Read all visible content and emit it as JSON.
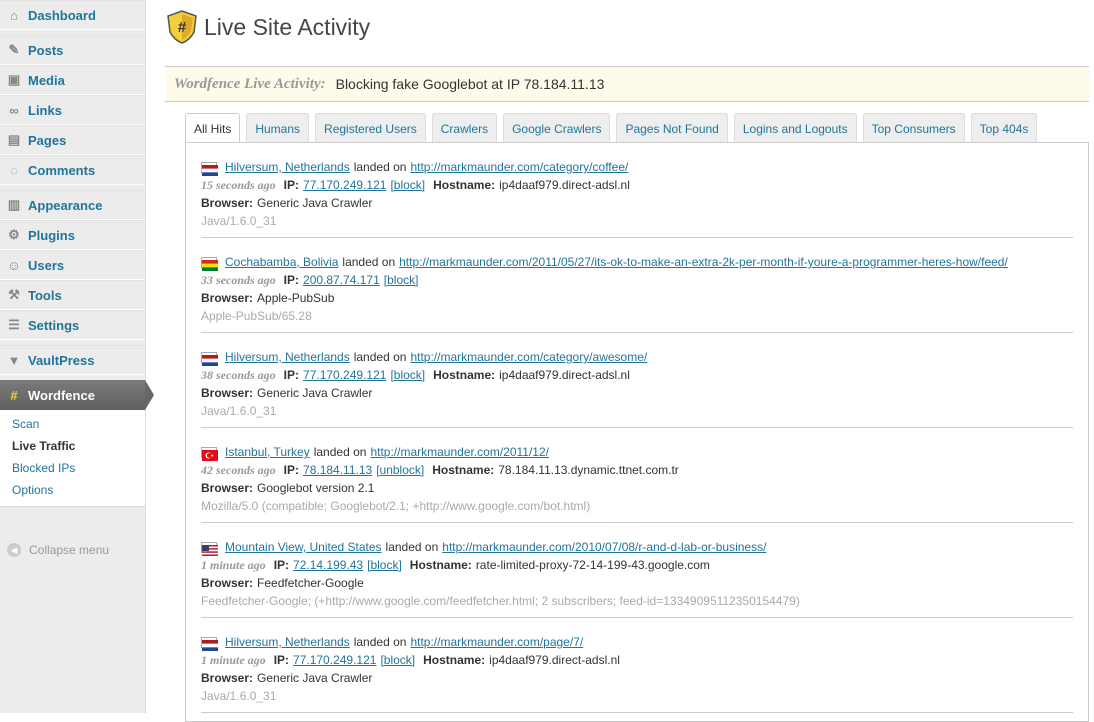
{
  "sidebar": {
    "items": [
      {
        "label": "Dashboard",
        "icon": "home-icon"
      },
      {
        "label": "Posts",
        "icon": "pin-icon"
      },
      {
        "label": "Media",
        "icon": "media-icon"
      },
      {
        "label": "Links",
        "icon": "link-icon"
      },
      {
        "label": "Pages",
        "icon": "pages-icon"
      },
      {
        "label": "Comments",
        "icon": "comment-icon"
      },
      {
        "label": "Appearance",
        "icon": "appearance-icon"
      },
      {
        "label": "Plugins",
        "icon": "plugin-icon"
      },
      {
        "label": "Users",
        "icon": "users-icon"
      },
      {
        "label": "Tools",
        "icon": "tools-icon"
      },
      {
        "label": "Settings",
        "icon": "settings-icon"
      },
      {
        "label": "VaultPress",
        "icon": "vaultpress-icon"
      },
      {
        "label": "Wordfence",
        "icon": "wordfence-icon"
      }
    ],
    "submenu": [
      "Scan",
      "Live Traffic",
      "Blocked IPs",
      "Options"
    ],
    "collapse": "Collapse menu"
  },
  "page": {
    "title": "Live Site Activity"
  },
  "livebar": {
    "label": "Wordfence Live Activity:",
    "message": "Blocking fake Googlebot at IP 78.184.11.13"
  },
  "tabs": [
    "All Hits",
    "Humans",
    "Registered Users",
    "Crawlers",
    "Google Crawlers",
    "Pages Not Found",
    "Logins and Logouts",
    "Top Consumers",
    "Top 404s"
  ],
  "labels": {
    "landed": "landed on",
    "ip": "IP:",
    "hostname": "Hostname:",
    "browser": "Browser:"
  },
  "hits": [
    {
      "location": "Hilversum, Netherlands",
      "url": "http://markmaunder.com/category/coffee/",
      "ago": "15 seconds ago",
      "ip": "77.170.249.121",
      "action": "[block]",
      "hostname": "ip4daaf979.direct-adsl.nl",
      "browser": "Generic Java Crawler",
      "ua": "Java/1.6.0_31",
      "flag": "nl"
    },
    {
      "location": "Cochabamba, Bolivia",
      "url": "http://markmaunder.com/2011/05/27/its-ok-to-make-an-extra-2k-per-month-if-youre-a-programmer-heres-how/feed/",
      "ago": "33 seconds ago",
      "ip": "200.87.74.171",
      "action": "[block]",
      "hostname": "",
      "browser": "Apple-PubSub",
      "ua": "Apple-PubSub/65.28",
      "flag": "bo"
    },
    {
      "location": "Hilversum, Netherlands",
      "url": "http://markmaunder.com/category/awesome/",
      "ago": "38 seconds ago",
      "ip": "77.170.249.121",
      "action": "[block]",
      "hostname": "ip4daaf979.direct-adsl.nl",
      "browser": "Generic Java Crawler",
      "ua": "Java/1.6.0_31",
      "flag": "nl"
    },
    {
      "location": "Istanbul, Turkey",
      "url": "http://markmaunder.com/2011/12/",
      "ago": "42 seconds ago",
      "ip": "78.184.11.13",
      "action": "[unblock]",
      "hostname": "78.184.11.13.dynamic.ttnet.com.tr",
      "browser": "Googlebot version 2.1",
      "ua": "Mozilla/5.0 (compatible; Googlebot/2.1; +http://www.google.com/bot.html)",
      "flag": "tr"
    },
    {
      "location": "Mountain View, United States",
      "url": "http://markmaunder.com/2010/07/08/r-and-d-lab-or-business/",
      "ago": "1 minute ago",
      "ip": "72.14.199.43",
      "action": "[block]",
      "hostname": "rate-limited-proxy-72-14-199-43.google.com",
      "browser": "Feedfetcher-Google",
      "ua": "Feedfetcher-Google; (+http://www.google.com/feedfetcher.html; 2 subscribers; feed-id=13349095112350154479)",
      "flag": "us"
    },
    {
      "location": "Hilversum, Netherlands",
      "url": "http://markmaunder.com/page/7/",
      "ago": "1 minute ago",
      "ip": "77.170.249.121",
      "action": "[block]",
      "hostname": "ip4daaf979.direct-adsl.nl",
      "browser": "Generic Java Crawler",
      "ua": "Java/1.6.0_31",
      "flag": "nl"
    }
  ]
}
